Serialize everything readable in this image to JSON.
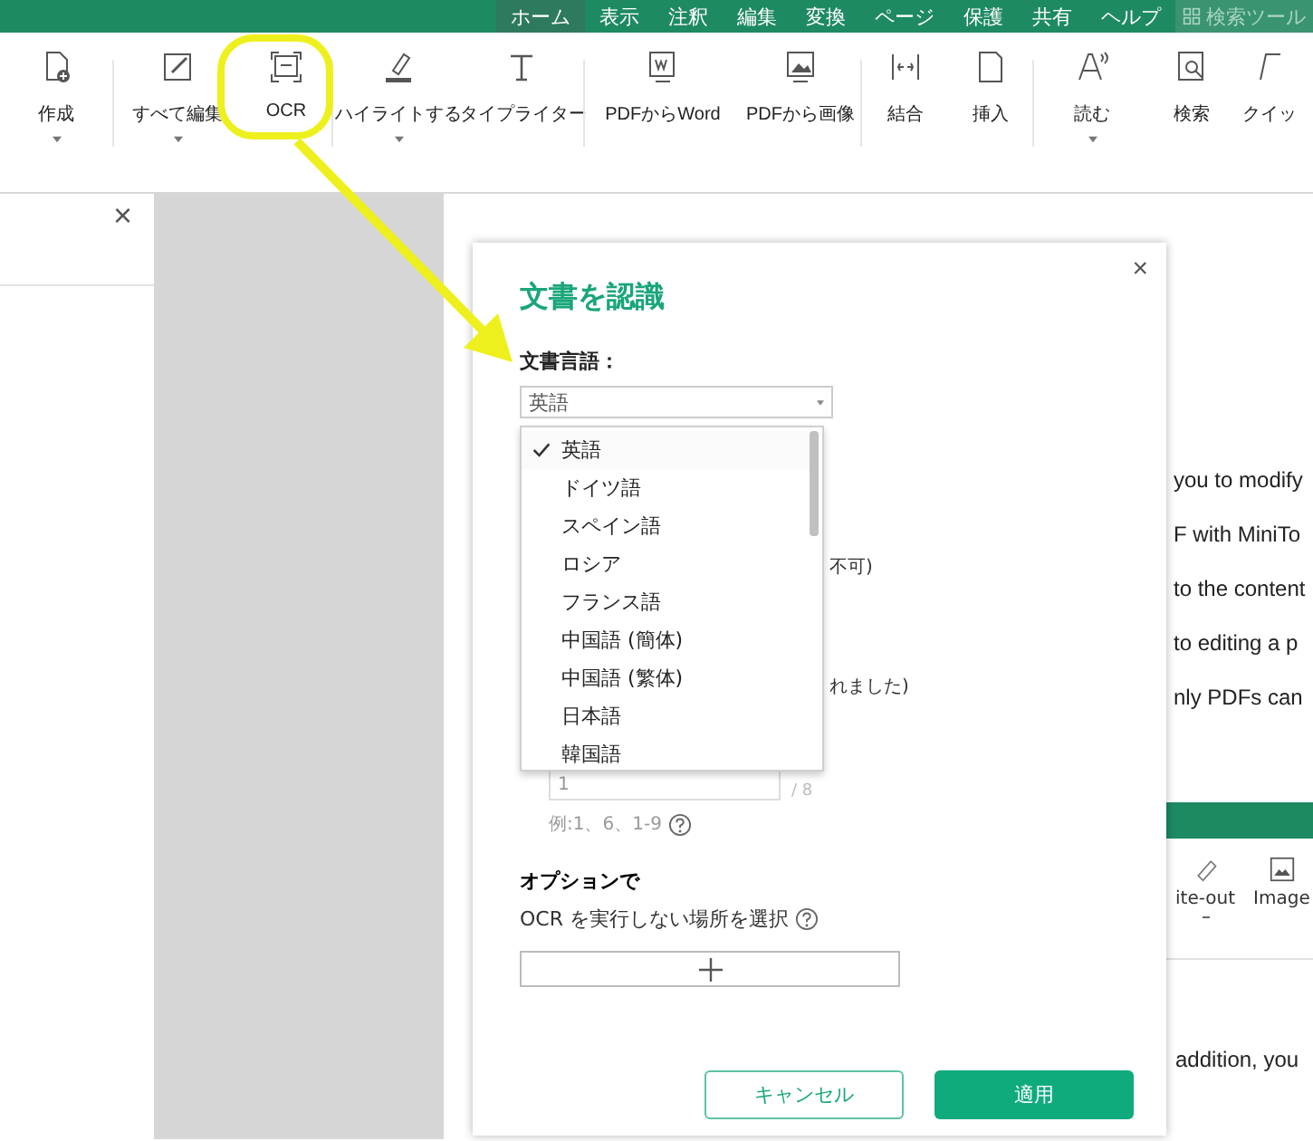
{
  "menu_tabs": [
    {
      "label": "ホーム",
      "selected": true
    },
    {
      "label": "表示",
      "selected": false
    },
    {
      "label": "注釈",
      "selected": false
    },
    {
      "label": "編集",
      "selected": false
    },
    {
      "label": "変換",
      "selected": false
    },
    {
      "label": "ページ",
      "selected": false
    },
    {
      "label": "保護",
      "selected": false
    },
    {
      "label": "共有",
      "selected": false
    },
    {
      "label": "ヘルプ",
      "selected": false
    }
  ],
  "search_tool": {
    "label": "検索ツール",
    "disabled": true
  },
  "toolbar": [
    {
      "label": "作成",
      "dropdown": true
    },
    {
      "label": "すべて編集",
      "dropdown": true
    },
    {
      "label": "OCR",
      "dropdown": false
    },
    {
      "label": "ハイライトする",
      "dropdown": true
    },
    {
      "label": "タイプライター",
      "dropdown": false
    },
    {
      "label": "PDFからWord",
      "dropdown": false
    },
    {
      "label": "PDFから画像",
      "dropdown": false
    },
    {
      "label": "結合",
      "dropdown": false
    },
    {
      "label": "挿入",
      "dropdown": false
    },
    {
      "label": "読む",
      "dropdown": true
    },
    {
      "label": "検索",
      "dropdown": false
    },
    {
      "label": "クイッ",
      "dropdown": false
    }
  ],
  "left_panel": {
    "close": "×"
  },
  "document": {
    "lines": [
      "you to modify",
      "F with MiniTo",
      "to the content",
      "to editing a p",
      "nly PDFs can"
    ],
    "embedded_toolbar": [
      {
        "label": "ite-out",
        "dropdown": true
      },
      {
        "label": "Image",
        "dropdown": false
      }
    ],
    "bottom_line": "addition, you"
  },
  "dialog": {
    "title": "文書を認識",
    "close": "×",
    "language_label": "文書言語：",
    "language_select": {
      "value": "英語"
    },
    "language_options": [
      {
        "label": "英語",
        "selected": true
      },
      {
        "label": "ドイツ語",
        "selected": false
      },
      {
        "label": "スペイン語",
        "selected": false
      },
      {
        "label": "ロシア",
        "selected": false
      },
      {
        "label": "フランス語",
        "selected": false
      },
      {
        "label": "中国語 (簡体)",
        "selected": false
      },
      {
        "label": "中国語 (繁体)",
        "selected": false
      },
      {
        "label": "日本語",
        "selected": false
      },
      {
        "label": "韓国語",
        "selected": false
      }
    ],
    "hidden_fragments": [
      "不可)",
      "れました)"
    ],
    "page_field": {
      "value": "1"
    },
    "page_total": "/ 8",
    "page_example": "例:1、6、1-9",
    "options_heading": "オプションで",
    "exclude_label": "OCR を実行しない場所を選択",
    "cancel": "キャンセル",
    "apply": "適用"
  }
}
